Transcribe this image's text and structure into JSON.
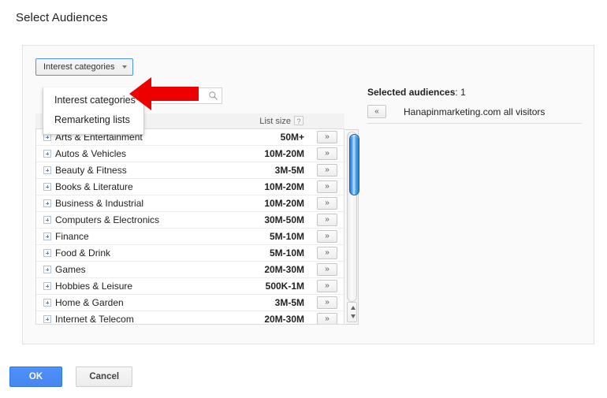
{
  "page": {
    "title": "Select Audiences"
  },
  "dropdown": {
    "button_label": "Interest categories",
    "caret_icon": "chevron-down-icon",
    "open": true,
    "items": [
      {
        "label": "Interest categories"
      },
      {
        "label": "Remarketing lists"
      }
    ]
  },
  "search": {
    "value": "",
    "placeholder": "",
    "icon": "search-icon"
  },
  "list": {
    "size_column_header": "List size",
    "help_badge": "?",
    "expand_icon": "plus-box-icon",
    "add_button_label": "»",
    "rows": [
      {
        "name": "Arts & Entertainment",
        "size": "50M+"
      },
      {
        "name": "Autos & Vehicles",
        "size": "10M-20M"
      },
      {
        "name": "Beauty & Fitness",
        "size": "3M-5M"
      },
      {
        "name": "Books & Literature",
        "size": "10M-20M"
      },
      {
        "name": "Business & Industrial",
        "size": "10M-20M"
      },
      {
        "name": "Computers & Electronics",
        "size": "30M-50M"
      },
      {
        "name": "Finance",
        "size": "5M-10M"
      },
      {
        "name": "Food & Drink",
        "size": "5M-10M"
      },
      {
        "name": "Games",
        "size": "20M-30M"
      },
      {
        "name": "Hobbies & Leisure",
        "size": "500K-1M"
      },
      {
        "name": "Home & Garden",
        "size": "3M-5M"
      },
      {
        "name": "Internet & Telecom",
        "size": "20M-30M"
      }
    ]
  },
  "scrollbar": {
    "up_arrow_icon": "triangle-up-icon",
    "down_arrow_icon": "triangle-down-icon",
    "thumb_color": "#4fa2ef"
  },
  "selected": {
    "title_label": "Selected audiences",
    "count": "1",
    "remove_button_label": "«",
    "items": [
      {
        "name": "Hanapinmarketing.com all visitors"
      }
    ]
  },
  "footer": {
    "ok_label": "OK",
    "cancel_label": "Cancel",
    "ok_color": "#4d90fe"
  },
  "annotation": {
    "arrow_icon": "arrow-left-icon",
    "arrow_color": "#ee0000"
  }
}
